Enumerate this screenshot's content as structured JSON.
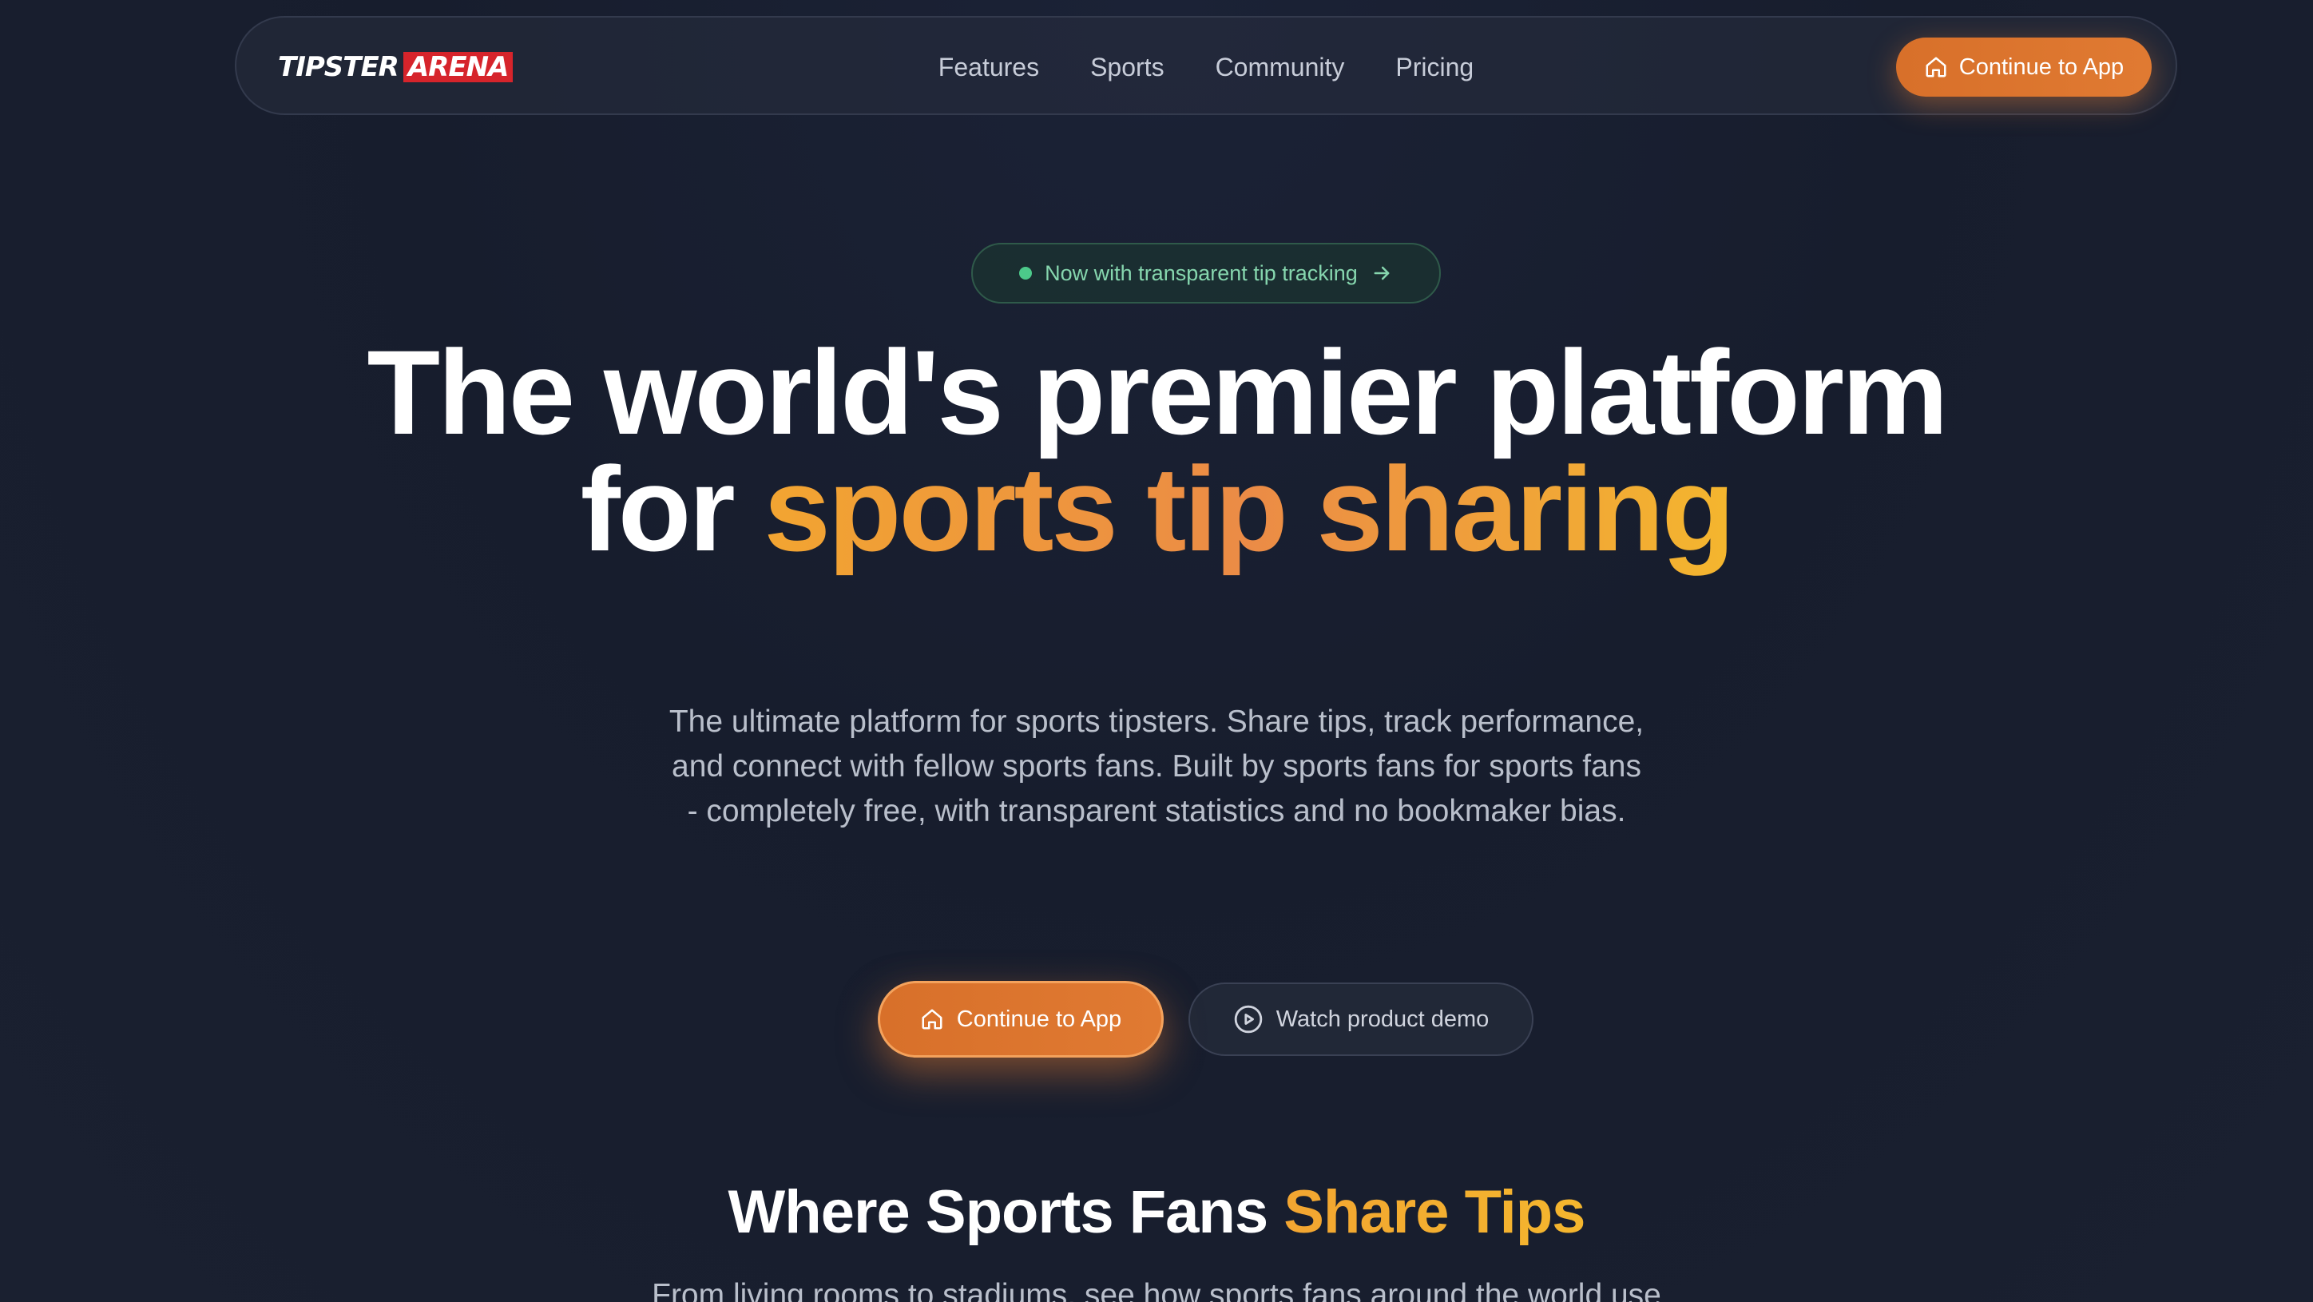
{
  "brand": {
    "word1": "TIPSTER",
    "word2": "ARENA",
    "accent_color": "#e07a32",
    "logo_red": "#d6242b"
  },
  "nav": {
    "links": [
      "Features",
      "Sports",
      "Community",
      "Pricing"
    ],
    "cta_label": "Continue to App",
    "cta_icon": "home-icon"
  },
  "badge": {
    "text": "Now with transparent tip tracking",
    "icon": "arrow-right-icon"
  },
  "hero": {
    "title_line1": "The world's premier platform",
    "title_line2_prefix": "for ",
    "title_line2_accent": "sports tip sharing",
    "subtitle": "The ultimate platform for sports tipsters. Share tips, track performance, and connect with fellow sports fans. Built by sports fans for sports fans - completely free, with transparent statistics and no bookmaker bias.",
    "primary_button": "Continue to App",
    "secondary_button": "Watch product demo",
    "secondary_icon": "play-circle-icon"
  },
  "section": {
    "title_prefix": "Where Sports Fans ",
    "title_accent": "Share Tips",
    "subtitle": "From living rooms to stadiums, see how sports fans around the world use"
  }
}
